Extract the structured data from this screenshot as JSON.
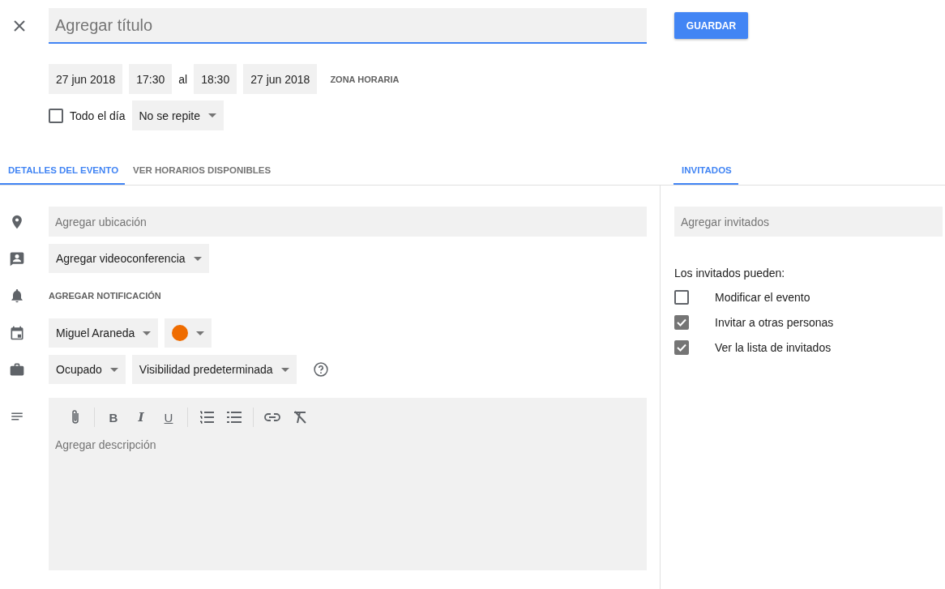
{
  "title_field": {
    "placeholder": "Agregar título"
  },
  "save_button": "GUARDAR",
  "date_row": {
    "start_date": "27 jun 2018",
    "start_time": "17:30",
    "separator": "al",
    "end_time": "18:30",
    "end_date": "27 jun 2018",
    "timezone_button": "ZONA HORARIA"
  },
  "all_day": {
    "label": "Todo el día",
    "checked": false
  },
  "repeat_dropdown": "No se repite",
  "tabs": [
    {
      "label": "DETALLES DEL EVENTO",
      "selected": true
    },
    {
      "label": "VER HORARIOS DISPONIBLES",
      "selected": false
    }
  ],
  "guests_tab": {
    "label": "INVITADOS",
    "selected": true
  },
  "details": {
    "location_placeholder": "Agregar ubicación",
    "video_dropdown": "Agregar videoconferencia",
    "notification_button": "AGREGAR NOTIFICACIÓN",
    "calendar_dropdown": "Miguel Araneda",
    "color_picker": {
      "color": "#ef6c00"
    },
    "availability_dropdown": "Ocupado",
    "visibility_dropdown": "Visibilidad predeterminada"
  },
  "description": {
    "placeholder": "Agregar descripción",
    "format_buttons": [
      {
        "kind": "bold",
        "label": "B"
      },
      {
        "kind": "italic",
        "label": "I"
      },
      {
        "kind": "underline",
        "label": "U"
      }
    ]
  },
  "guests": {
    "placeholder": "Agregar invitados",
    "permissions_label": "Los invitados pueden:",
    "permissions": [
      {
        "label": "Modificar el evento",
        "checked": false
      },
      {
        "label": "Invitar a otras personas",
        "checked": true
      },
      {
        "label": "Ver la lista de invitados",
        "checked": true
      }
    ]
  }
}
